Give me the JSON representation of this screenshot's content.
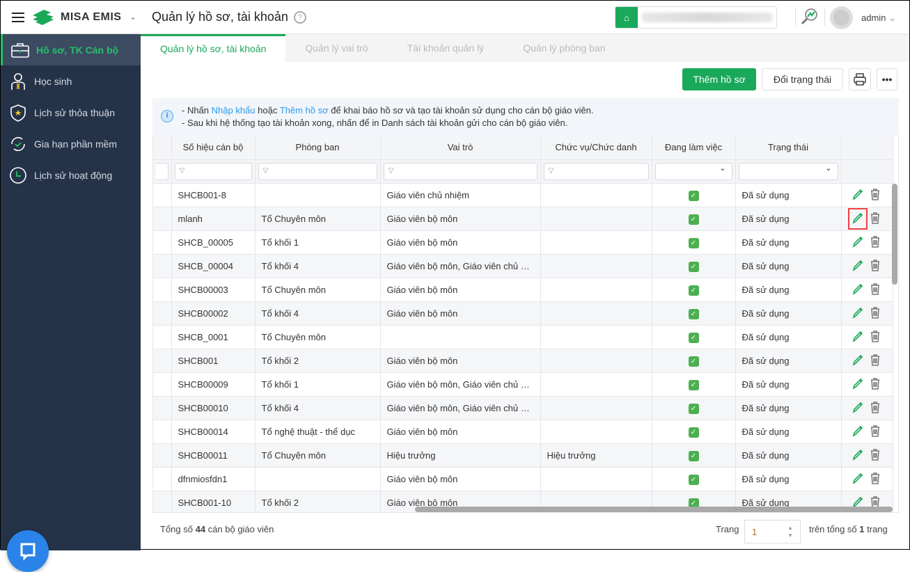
{
  "header": {
    "brand": "MISA EMIS",
    "title": "Quản lý hồ sơ, tài khoản",
    "user": "admin"
  },
  "sidebar": {
    "items": [
      {
        "label": "Hồ sơ, TK Cán bộ",
        "icon": "briefcase-icon"
      },
      {
        "label": "Học sinh",
        "icon": "student-icon"
      },
      {
        "label": "Lịch sử thỏa thuận",
        "icon": "shield-star-icon"
      },
      {
        "label": "Gia hạn phần mềm",
        "icon": "renew-icon"
      },
      {
        "label": "Lịch sử hoạt động",
        "icon": "clock-icon"
      }
    ]
  },
  "tabs": [
    "Quản lý hồ sơ, tài khoản",
    "Quản lý vai trò",
    "Tài khoản quản lý",
    "Quản lý phòng ban"
  ],
  "toolbar": {
    "add": "Thêm hồ sơ",
    "status": "Đổi trạng thái"
  },
  "info": {
    "l1a": "- Nhấn ",
    "l1b": "Nhập khẩu",
    "l1c": " hoặc ",
    "l1d": "Thêm hồ sơ",
    "l1e": " để khai báo hồ sơ và tạo tài khoản sử dụng cho cán bộ giáo viên.",
    "l2": "- Sau khi hệ thống tạo tài khoản xong, nhấn để in Danh sách tài khoản gửi cho cán bộ giáo viên."
  },
  "columns": [
    "Số hiệu cán bộ",
    "Phòng ban",
    "Vai trò",
    "Chức vụ/Chức danh",
    "Đang làm việc",
    "Trạng thái"
  ],
  "rows": [
    [
      "SHCB001-8",
      "",
      "Giáo viên chủ nhiệm",
      "",
      "Đã sử dụng"
    ],
    [
      "mlanh",
      "Tổ Chuyên môn",
      "Giáo viên bộ môn",
      "",
      "Đã sử dụng"
    ],
    [
      "SHCB_00005",
      "Tổ khối 1",
      "Giáo viên bộ môn",
      "",
      "Đã sử dụng"
    ],
    [
      "SHCB_00004",
      "Tổ khối 4",
      "Giáo viên bộ môn, Giáo viên chủ nhiệm",
      "",
      "Đã sử dụng"
    ],
    [
      "SHCB00003",
      "Tổ Chuyên môn",
      "Giáo viên bộ môn",
      "",
      "Đã sử dụng"
    ],
    [
      "SHCB00002",
      "Tổ khối 4",
      "Giáo viên bộ môn",
      "",
      "Đã sử dụng"
    ],
    [
      "SHCB_0001",
      "Tổ Chuyên môn",
      "",
      "",
      "Đã sử dụng"
    ],
    [
      "SHCB001",
      "Tổ khối 2",
      "Giáo viên bộ môn",
      "",
      "Đã sử dụng"
    ],
    [
      "SHCB00009",
      "Tổ khối 1",
      "Giáo viên bộ môn, Giáo viên chủ nhiệm",
      "",
      "Đã sử dụng"
    ],
    [
      "SHCB00010",
      "Tổ khối 4",
      "Giáo viên bộ môn, Giáo viên chủ nhiệm",
      "",
      "Đã sử dụng"
    ],
    [
      "SHCB00014",
      "Tổ nghệ thuật - thể dục",
      "Giáo viên bộ môn",
      "",
      "Đã sử dụng"
    ],
    [
      "SHCB00011",
      "Tổ Chuyên môn",
      "Hiệu trưởng",
      "Hiệu trưởng",
      "Đã sử dụng"
    ],
    [
      "dfnmiosfdn1",
      "",
      "Giáo viên bộ môn",
      "",
      "Đã sử dụng"
    ],
    [
      "SHCB001-10",
      "Tổ khối 2",
      "Giáo viên bộ môn",
      "",
      "Đã sử dụng"
    ]
  ],
  "footer": {
    "pre": "Tổng số ",
    "count": "44",
    "post": " cán bộ giáo viên",
    "page_label": "Trang",
    "page": "1",
    "total_pre": "trên tổng số ",
    "total": "1",
    "total_post": " trang"
  }
}
